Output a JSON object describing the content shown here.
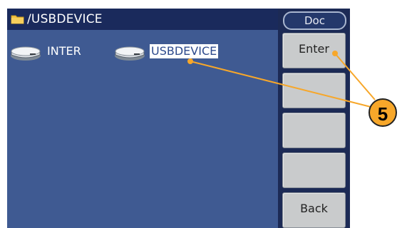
{
  "header": {
    "path": "/USBDEVICE"
  },
  "files": [
    {
      "label": "INTER",
      "icon": "drive-icon",
      "selected": false
    },
    {
      "label": "USBDEVICE",
      "icon": "drive-icon",
      "selected": true
    }
  ],
  "softkeys": {
    "doc_tab": "Doc",
    "keys": [
      "Enter",
      "",
      "",
      "",
      "Back"
    ]
  },
  "callout": {
    "number": "5"
  },
  "colors": {
    "accent": "#f7a72a",
    "title_bg": "#1a2a5c",
    "pane_bg": "#3f5a92",
    "softkey_bg": "#c9cbcc"
  }
}
